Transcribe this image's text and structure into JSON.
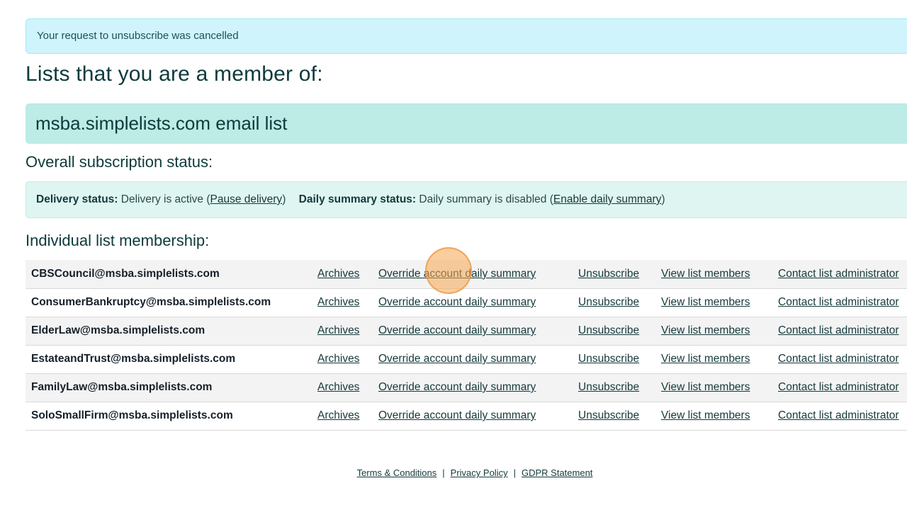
{
  "alert": {
    "message": "Your request to unsubscribe was cancelled"
  },
  "headings": {
    "members": "Lists that you are a member of:",
    "list_banner": "msba.simplelists.com email list",
    "overall_status": "Overall subscription status:",
    "individual": "Individual list membership:"
  },
  "status": {
    "delivery_label": "Delivery status:",
    "delivery_text": "Delivery is active",
    "delivery_link": "Pause delivery",
    "summary_label": "Daily summary status:",
    "summary_text": "Daily summary is disabled",
    "summary_link": "Enable daily summary"
  },
  "row_actions": {
    "archives": "Archives",
    "override": "Override account daily summary",
    "unsubscribe": "Unsubscribe",
    "view_members": "View list members",
    "contact_admin": "Contact list administrator"
  },
  "lists": [
    "CBSCouncil@msba.simplelists.com",
    "ConsumerBankruptcy@msba.simplelists.com",
    "ElderLaw@msba.simplelists.com",
    "EstateandTrust@msba.simplelists.com",
    "FamilyLaw@msba.simplelists.com",
    "SoloSmallFirm@msba.simplelists.com"
  ],
  "footer": {
    "terms": "Terms & Conditions",
    "privacy": "Privacy Policy",
    "gdpr": "GDPR Statement",
    "separator": "|"
  }
}
